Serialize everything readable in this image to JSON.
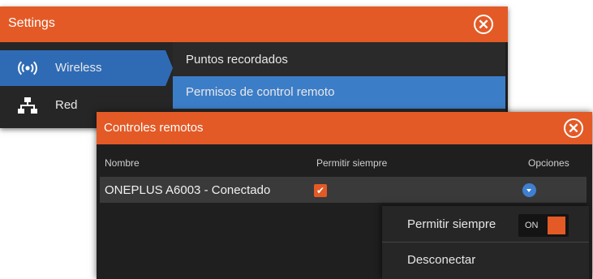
{
  "settings": {
    "title": "Settings",
    "sidebar": [
      {
        "label": "Wireless",
        "icon": "wireless-icon",
        "active": true
      },
      {
        "label": "Red",
        "icon": "network-icon",
        "active": false
      }
    ],
    "list": [
      {
        "label": "Puntos recordados",
        "selected": false
      },
      {
        "label": "Permisos de control remoto",
        "selected": true
      }
    ]
  },
  "dialog": {
    "title": "Controles remotos",
    "columns": {
      "name": "Nombre",
      "allow": "Permitir siempre",
      "options": "Opciones"
    },
    "device": {
      "name": "ONEPLUS A6003 - Conectado",
      "allow_always": true
    }
  },
  "popup": {
    "allow_label": "Permitir siempre",
    "toggle_state": "ON",
    "disconnect_label": "Desconectar"
  },
  "colors": {
    "accent": "#e35a26",
    "selection": "#3c7dc8"
  }
}
